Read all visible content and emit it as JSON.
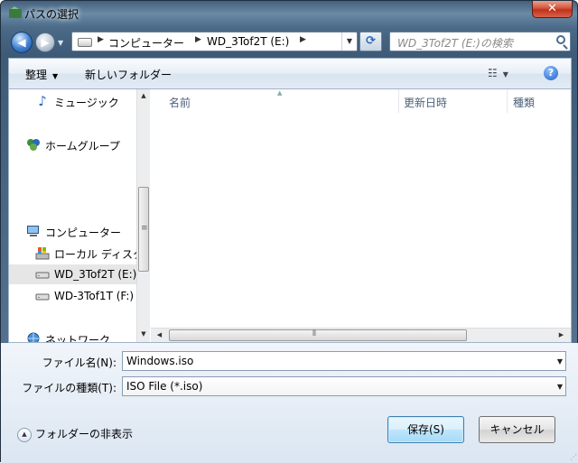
{
  "window": {
    "title": "パスの選択",
    "close_label": "✕"
  },
  "nav": {
    "address_segments": [
      "コンピューター",
      "WD_3Tof2T (E:)"
    ],
    "search_placeholder": "WD_3Tof2T (E:)の検索"
  },
  "toolbar": {
    "organize_label": "整理",
    "new_folder_label": "新しいフォルダー",
    "help_label": "?"
  },
  "sidebar": {
    "items": [
      {
        "label": "ミュージック",
        "icon": "music-note-icon"
      },
      {
        "label": "ホームグループ",
        "icon": "homegroup-icon"
      },
      {
        "label": "コンピューター",
        "icon": "computer-icon"
      },
      {
        "label": "ローカル ディスク",
        "icon": "local-disk-icon"
      },
      {
        "label": "WD_3Tof2T (E:)",
        "icon": "drive-icon"
      },
      {
        "label": "WD-3Tof1T (F:)",
        "icon": "drive-icon"
      },
      {
        "label": "ネットワーク",
        "icon": "network-icon"
      }
    ]
  },
  "columns": [
    "名前",
    "更新日時",
    "種類"
  ],
  "form": {
    "filename_label": "ファイル名(N):",
    "filename_value": "Windows.iso",
    "filetype_label": "ファイルの種類(T):",
    "filetype_value": "ISO File (*.iso)"
  },
  "buttons": {
    "save": "保存(S)",
    "cancel": "キャンセル"
  },
  "hide_folders_label": "フォルダーの非表示"
}
